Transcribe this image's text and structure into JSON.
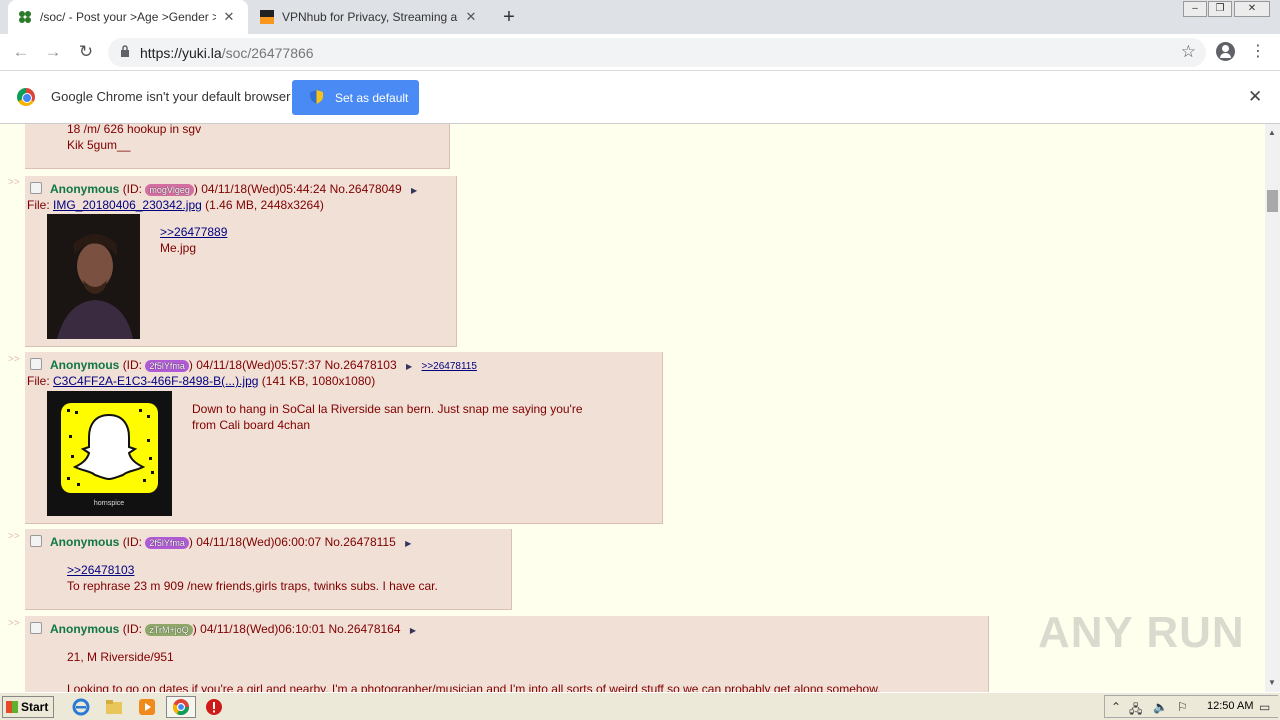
{
  "browser": {
    "tabs": [
      {
        "title": "/soc/ - Post your >Age >Gender >A",
        "active": true
      },
      {
        "title": "VPNhub for Privacy, Streaming and N",
        "active": false
      }
    ],
    "url_host": "https://yuki.la",
    "url_path": "/soc/26477866"
  },
  "infobar": {
    "message": "Google Chrome isn't your default browser",
    "button": "Set as default"
  },
  "posts": [
    {
      "lines": [
        "18 /m/ 626 hookup in sgv",
        "Kik 5gum__"
      ]
    },
    {
      "name": "Anonymous",
      "id": "mogVlgeg",
      "id_color": "#d36ea0",
      "datetime": "04/11/18(Wed)05:44:24",
      "no": "No.26478049",
      "file_link": "IMG_20180406_230342.jpg",
      "file_meta": "(1.46 MB, 2448x3264)",
      "quote": ">>26477889",
      "text": "Me.jpg"
    },
    {
      "name": "Anonymous",
      "id": "2f5lYfma",
      "id_color": "#b05ad6",
      "datetime": "04/11/18(Wed)05:57:37",
      "no": "No.26478103",
      "backlink": ">>26478115",
      "file_link": "C3C4FF2A-E1C3-466F-8498-B(...).jpg",
      "file_meta": "(141 KB, 1080x1080)",
      "lines": [
        "Down to hang in SoCal la Riverside san bern. Just snap me saying you're",
        "from Cali board 4chan"
      ],
      "snap_caption": "hornspice"
    },
    {
      "name": "Anonymous",
      "id": "2f5lYfma",
      "id_color": "#b05ad6",
      "datetime": "04/11/18(Wed)06:00:07",
      "no": "No.26478115",
      "quote": ">>26478103",
      "text": "To rephrase 23 m 909 /new friends,girls traps, twinks subs. I have car."
    },
    {
      "name": "Anonymous",
      "id": "zTrM+joQ",
      "id_color": "#8fa86a",
      "datetime": "04/11/18(Wed)06:10:01",
      "no": "No.26478164",
      "lines": [
        "21, M Riverside/951",
        "Looking to go on dates if you're a girl and nearby. I'm a photographer/musician and I'm into all sorts of weird stuff so we can probably get along somehow."
      ]
    }
  ],
  "labels": {
    "file_prefix": "File:",
    "id_open": "(ID:",
    "id_close": ")",
    "arrow": ">>"
  },
  "watermark": "ANY RUN",
  "taskbar": {
    "start": "Start",
    "clock": "12:50 AM"
  }
}
